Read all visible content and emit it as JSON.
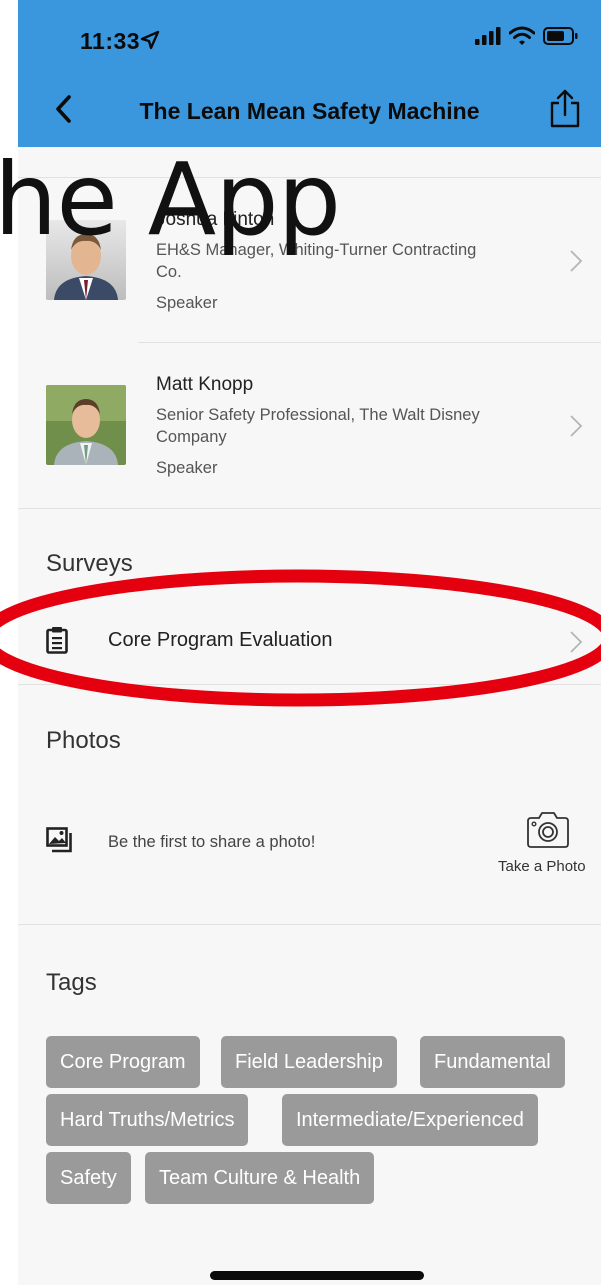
{
  "status_bar": {
    "time": "11:33"
  },
  "nav": {
    "title": "The Lean Mean Safety Machine"
  },
  "overlay": {
    "text": "he App"
  },
  "speakers": [
    {
      "name": "Joshua Linton",
      "title": "EH&S Manager, Whiting-Turner Contracting Co.",
      "role": "Speaker"
    },
    {
      "name": "Matt Knopp",
      "title": "Senior Safety Professional, The Walt Disney Company",
      "role": "Speaker"
    }
  ],
  "surveys": {
    "heading": "Surveys",
    "items": [
      {
        "label": "Core Program Evaluation"
      }
    ]
  },
  "photos": {
    "heading": "Photos",
    "empty_message": "Be the first to share a photo!",
    "take_photo_label": "Take a Photo"
  },
  "tags": {
    "heading": "Tags",
    "items": [
      "Core Program",
      "Field Leadership",
      "Fundamental",
      "Hard Truths/Metrics",
      "Intermediate/Experienced",
      "Safety",
      "Team Culture & Health"
    ]
  },
  "colors": {
    "header": "#3a97dd",
    "tag_bg": "#9a9a9a",
    "highlight": "#e4000f"
  }
}
